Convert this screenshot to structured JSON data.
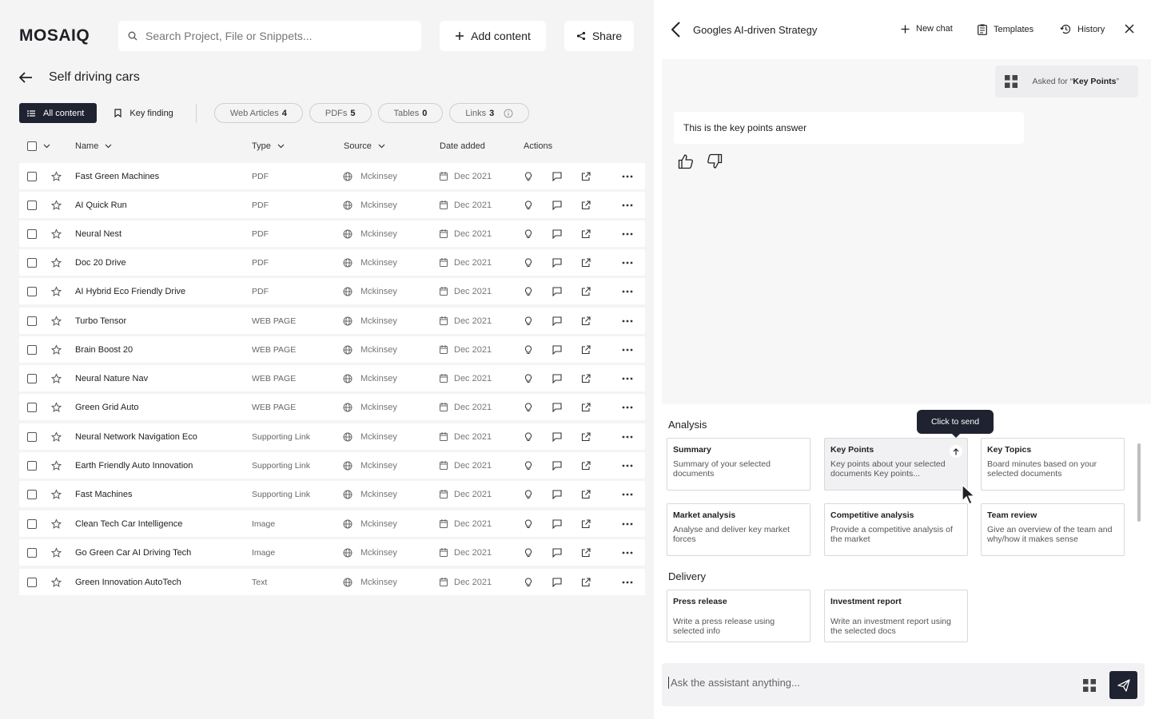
{
  "app": {
    "logo": "MOSAIQ"
  },
  "header": {
    "search_placeholder": "Search Project, File or Snippets...",
    "add_content_label": "Add content",
    "share_label": "Share"
  },
  "page": {
    "title": "Self driving cars"
  },
  "filters": {
    "all_content": "All content",
    "key_finding": "Key finding",
    "chips": [
      {
        "label": "Web Articles",
        "count": "4"
      },
      {
        "label": "PDFs",
        "count": "5"
      },
      {
        "label": "Tables",
        "count": "0"
      },
      {
        "label": "Links",
        "count": "3"
      }
    ]
  },
  "table": {
    "headers": {
      "name": "Name",
      "type": "Type",
      "source": "Source",
      "date": "Date added",
      "actions": "Actions"
    },
    "rows": [
      {
        "name": "Fast Green Machines",
        "type": "PDF",
        "source": "Mckinsey",
        "date": "Dec 2021"
      },
      {
        "name": "AI Quick Run",
        "type": "PDF",
        "source": "Mckinsey",
        "date": "Dec 2021"
      },
      {
        "name": "Neural Nest",
        "type": "PDF",
        "source": "Mckinsey",
        "date": "Dec 2021"
      },
      {
        "name": "Doc 20 Drive",
        "type": "PDF",
        "source": "Mckinsey",
        "date": "Dec 2021"
      },
      {
        "name": "AI Hybrid Eco Friendly Drive",
        "type": "PDF",
        "source": "Mckinsey",
        "date": "Dec 2021"
      },
      {
        "name": "Turbo Tensor",
        "type": "WEB PAGE",
        "source": "Mckinsey",
        "date": "Dec 2021"
      },
      {
        "name": "Brain Boost 20",
        "type": "WEB PAGE",
        "source": "Mckinsey",
        "date": "Dec 2021"
      },
      {
        "name": "Neural Nature Nav",
        "type": "WEB PAGE",
        "source": "Mckinsey",
        "date": "Dec 2021"
      },
      {
        "name": "Green Grid Auto",
        "type": "WEB PAGE",
        "source": "Mckinsey",
        "date": "Dec 2021"
      },
      {
        "name": "Neural Network Navigation Eco",
        "type": "Supporting Link",
        "source": "Mckinsey",
        "date": "Dec 2021"
      },
      {
        "name": "Earth Friendly Auto Innovation",
        "type": "Supporting Link",
        "source": "Mckinsey",
        "date": "Dec 2021"
      },
      {
        "name": "Fast Machines",
        "type": "Supporting Link",
        "source": "Mckinsey",
        "date": "Dec 2021"
      },
      {
        "name": "Clean Tech Car Intelligence",
        "type": "Image",
        "source": "Mckinsey",
        "date": "Dec 2021"
      },
      {
        "name": "Go Green Car AI Driving Tech",
        "type": "Image",
        "source": "Mckinsey",
        "date": "Dec 2021"
      },
      {
        "name": "Green Innovation AutoTech",
        "type": "Text",
        "source": "Mckinsey",
        "date": "Dec 2021"
      }
    ]
  },
  "chat": {
    "title": "Googles AI-driven Strategy",
    "new_chat": "New chat",
    "templates": "Templates",
    "history": "History",
    "asked_prefix": "Asked for “",
    "asked_value": "Key Points",
    "asked_suffix": "”",
    "answer": "This is the key points answer",
    "input_placeholder": "Ask the assistant anything...",
    "tooltip": "Click to send"
  },
  "templates": {
    "analysis_title": "Analysis",
    "delivery_title": "Delivery",
    "analysis": [
      {
        "title": "Summary",
        "desc": "Summary of your selected documents"
      },
      {
        "title": "Key Points",
        "desc": "Key points about your selected documents Key points..."
      },
      {
        "title": "Key Topics",
        "desc": "Board minutes based on your selected documents"
      },
      {
        "title": "Market analysis",
        "desc": "Analyse and deliver key market forces"
      },
      {
        "title": "Competitive analysis",
        "desc": "Provide a competitive analysis of the market"
      },
      {
        "title": "Team review",
        "desc": "Give an overview of the team and why/how it makes sense"
      }
    ],
    "delivery": [
      {
        "title": "Press release",
        "desc": "Write a press release using selected info"
      },
      {
        "title": "Investment report",
        "desc": "Write an investment report using the selected docs"
      }
    ]
  },
  "colors": {
    "accent": "#1f2230",
    "background": "#f4f4f5",
    "panel": "#ffffff"
  }
}
